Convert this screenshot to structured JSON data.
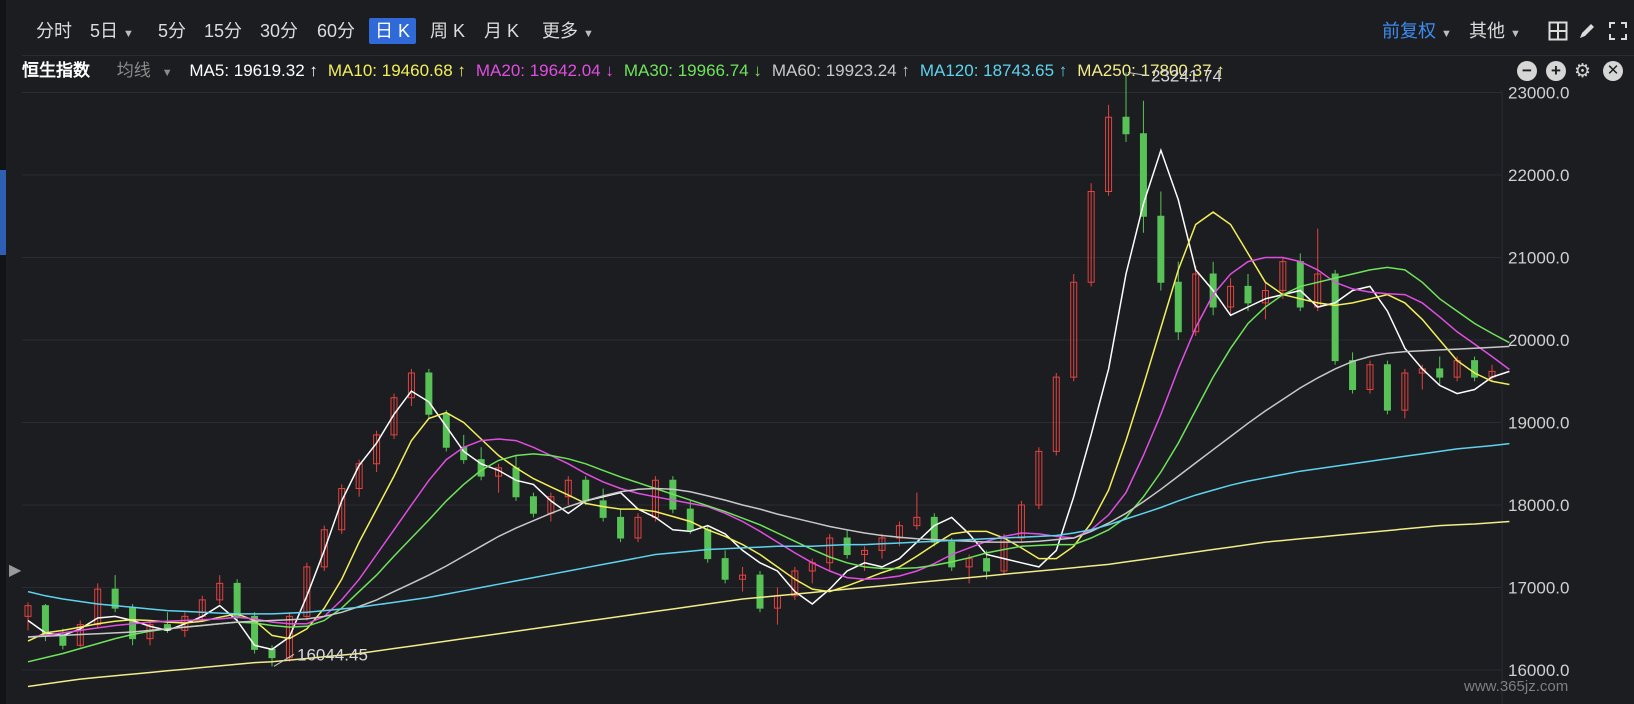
{
  "toolbar": {
    "timeframes": [
      {
        "label": "分时",
        "caret": false,
        "active": false
      },
      {
        "label": "5日",
        "caret": true,
        "active": false
      },
      {
        "label": "5分",
        "caret": false,
        "active": false
      },
      {
        "label": "15分",
        "caret": false,
        "active": false
      },
      {
        "label": "30分",
        "caret": false,
        "active": false
      },
      {
        "label": "60分",
        "caret": false,
        "active": false
      },
      {
        "label": "日 K",
        "caret": false,
        "active": true
      },
      {
        "label": "周 K",
        "caret": false,
        "active": false
      },
      {
        "label": "月 K",
        "caret": false,
        "active": false
      },
      {
        "label": "更多",
        "caret": true,
        "active": false
      }
    ],
    "adjust_label": "前复权",
    "other_label": "其他",
    "icons": [
      "layout-icon",
      "draw-tool-icon",
      "fullscreen-icon"
    ]
  },
  "ma_bar": {
    "index_name": "恒生指数",
    "avg_label": "均线",
    "items": [
      {
        "text": "MA5: 19619.32 ↑",
        "color": "#ffffff"
      },
      {
        "text": "MA10: 19460.68 ↑",
        "color": "#f3ef5a"
      },
      {
        "text": "MA20: 19642.04 ↓",
        "color": "#e04ee0"
      },
      {
        "text": "MA30: 19966.74 ↓",
        "color": "#6fe35a"
      },
      {
        "text": "MA60: 19923.24 ↑",
        "color": "#c8c8c8"
      },
      {
        "text": "MA120: 18743.65 ↑",
        "color": "#5fd3ee"
      },
      {
        "text": "MA250: 17800.37 ↑",
        "color": "#f2ec8a"
      }
    ],
    "controls": [
      "minus-icon",
      "plus-icon",
      "gear-icon",
      "close-icon"
    ]
  },
  "watermark": "www.365jz.com",
  "colors": {
    "up": "#e2433f",
    "down": "#58c257",
    "bg": "#1b1d21",
    "grid": "#2a2c31",
    "accent": "#2f6ad8"
  },
  "chart_data": {
    "type": "candlestick",
    "y_ticks": [
      "23000.0",
      "22000.0",
      "21000.0",
      "20000.0",
      "19000.0",
      "18000.0",
      "17000.0",
      "16000.0"
    ],
    "ylim": [
      15900,
      23450
    ],
    "annotations": [
      {
        "text": "23241.74",
        "value": 23241.74,
        "kind": "high"
      },
      {
        "text": "16044.45",
        "value": 16044.45,
        "kind": "low"
      }
    ],
    "series": [
      {
        "name": "MA5",
        "color": "#ffffff",
        "values": [
          16600,
          16450,
          16420,
          16500,
          16630,
          16650,
          16600,
          16530,
          16480,
          16560,
          16650,
          16780,
          16600,
          16300,
          16250,
          16400,
          16900,
          17450,
          18050,
          18480,
          18750,
          19100,
          19380,
          19250,
          18950,
          18650,
          18500,
          18420,
          18300,
          18250,
          18050,
          17900,
          18050,
          18100,
          18150,
          17950,
          17850,
          17700,
          17680,
          17750,
          17650,
          17450,
          17300,
          17200,
          16950,
          16800,
          16980,
          17200,
          17300,
          17250,
          17350,
          17550,
          17750,
          17850,
          17650,
          17400,
          17350,
          17300,
          17250,
          17450,
          18100,
          18850,
          19650,
          20800,
          21650,
          22300,
          21700,
          20850,
          20600,
          20300,
          20400,
          20500,
          20550,
          20600,
          20400,
          20450,
          20600,
          20650,
          20350,
          19900,
          19650,
          19450,
          19350,
          19400,
          19550,
          19619
        ]
      },
      {
        "name": "MA10",
        "color": "#f3ef5a",
        "values": [
          16350,
          16450,
          16480,
          16520,
          16560,
          16590,
          16610,
          16600,
          16580,
          16570,
          16590,
          16640,
          16680,
          16600,
          16420,
          16380,
          16500,
          16750,
          17100,
          17550,
          17950,
          18350,
          18780,
          19050,
          19120,
          19000,
          18800,
          18600,
          18450,
          18320,
          18220,
          18120,
          18020,
          17980,
          17950,
          17950,
          17920,
          17860,
          17800,
          17700,
          17620,
          17520,
          17400,
          17250,
          17100,
          16980,
          16950,
          17020,
          17100,
          17180,
          17250,
          17380,
          17520,
          17650,
          17680,
          17680,
          17600,
          17480,
          17350,
          17350,
          17500,
          17780,
          18180,
          18780,
          19450,
          20150,
          20850,
          21400,
          21550,
          21400,
          21050,
          20700,
          20550,
          20500,
          20450,
          20420,
          20450,
          20500,
          20550,
          20450,
          20250,
          20000,
          19750,
          19600,
          19500,
          19461
        ]
      },
      {
        "name": "MA20",
        "color": "#e04ee0",
        "values": [
          16400,
          16420,
          16450,
          16480,
          16510,
          16540,
          16560,
          16580,
          16590,
          16600,
          16610,
          16620,
          16640,
          16620,
          16580,
          16560,
          16560,
          16650,
          16850,
          17100,
          17400,
          17700,
          18000,
          18300,
          18550,
          18700,
          18780,
          18800,
          18780,
          18700,
          18600,
          18500,
          18380,
          18280,
          18200,
          18140,
          18100,
          18060,
          18020,
          17980,
          17900,
          17800,
          17680,
          17550,
          17420,
          17300,
          17200,
          17120,
          17100,
          17110,
          17140,
          17200,
          17290,
          17400,
          17480,
          17560,
          17620,
          17660,
          17650,
          17620,
          17600,
          17700,
          17880,
          18150,
          18600,
          19100,
          19650,
          20150,
          20550,
          20800,
          20950,
          21000,
          21000,
          20950,
          20850,
          20700,
          20620,
          20580,
          20560,
          20550,
          20450,
          20280,
          20100,
          19950,
          19800,
          19642
        ]
      },
      {
        "name": "MA30",
        "color": "#6fe35a",
        "values": [
          16100,
          16150,
          16200,
          16260,
          16320,
          16380,
          16430,
          16470,
          16500,
          16520,
          16540,
          16560,
          16580,
          16570,
          16540,
          16520,
          16530,
          16600,
          16750,
          16950,
          17150,
          17380,
          17600,
          17820,
          18050,
          18250,
          18420,
          18540,
          18600,
          18620,
          18600,
          18560,
          18500,
          18420,
          18340,
          18270,
          18200,
          18130,
          18060,
          17990,
          17920,
          17840,
          17760,
          17660,
          17560,
          17460,
          17370,
          17300,
          17250,
          17230,
          17230,
          17240,
          17270,
          17310,
          17360,
          17420,
          17460,
          17500,
          17510,
          17520,
          17520,
          17600,
          17700,
          17850,
          18100,
          18400,
          18750,
          19150,
          19550,
          19900,
          20200,
          20400,
          20550,
          20650,
          20700,
          20750,
          20800,
          20850,
          20880,
          20850,
          20700,
          20500,
          20350,
          20200,
          20080,
          19967
        ]
      },
      {
        "name": "MA60",
        "color": "#c8c8c8",
        "values": [
          16400,
          16410,
          16420,
          16430,
          16440,
          16450,
          16460,
          16480,
          16500,
          16520,
          16540,
          16560,
          16580,
          16590,
          16600,
          16610,
          16620,
          16650,
          16700,
          16770,
          16850,
          16950,
          17050,
          17150,
          17260,
          17380,
          17500,
          17620,
          17720,
          17810,
          17900,
          17980,
          18050,
          18110,
          18160,
          18190,
          18200,
          18190,
          18160,
          18110,
          18060,
          18000,
          17950,
          17890,
          17840,
          17790,
          17740,
          17700,
          17660,
          17630,
          17610,
          17590,
          17580,
          17570,
          17560,
          17550,
          17550,
          17550,
          17560,
          17580,
          17600,
          17680,
          17780,
          17900,
          18040,
          18190,
          18350,
          18510,
          18670,
          18830,
          18990,
          19140,
          19280,
          19420,
          19540,
          19650,
          19740,
          19800,
          19840,
          19860,
          19870,
          19880,
          19890,
          19900,
          19910,
          19923
        ]
      },
      {
        "name": "MA120",
        "color": "#5fd3ee",
        "values": [
          16950,
          16900,
          16860,
          16830,
          16800,
          16780,
          16760,
          16740,
          16720,
          16710,
          16700,
          16690,
          16680,
          16680,
          16680,
          16690,
          16700,
          16720,
          16740,
          16760,
          16790,
          16820,
          16850,
          16880,
          16920,
          16960,
          17000,
          17040,
          17080,
          17120,
          17160,
          17200,
          17240,
          17280,
          17320,
          17360,
          17400,
          17420,
          17440,
          17460,
          17470,
          17480,
          17490,
          17500,
          17500,
          17500,
          17510,
          17520,
          17520,
          17530,
          17540,
          17550,
          17560,
          17570,
          17580,
          17590,
          17600,
          17610,
          17620,
          17630,
          17660,
          17700,
          17760,
          17830,
          17900,
          17970,
          18050,
          18120,
          18180,
          18240,
          18290,
          18330,
          18370,
          18410,
          18440,
          18470,
          18500,
          18530,
          18560,
          18590,
          18620,
          18650,
          18680,
          18700,
          18720,
          18744
        ]
      },
      {
        "name": "MA250",
        "color": "#f2ec8a",
        "values": [
          15800,
          15830,
          15860,
          15890,
          15910,
          15930,
          15950,
          15970,
          15990,
          16010,
          16030,
          16050,
          16070,
          16090,
          16100,
          16120,
          16140,
          16160,
          16180,
          16200,
          16230,
          16260,
          16290,
          16320,
          16350,
          16380,
          16410,
          16440,
          16470,
          16500,
          16530,
          16560,
          16590,
          16620,
          16650,
          16680,
          16710,
          16740,
          16770,
          16800,
          16830,
          16860,
          16880,
          16900,
          16920,
          16940,
          16960,
          16980,
          17000,
          17020,
          17040,
          17060,
          17080,
          17100,
          17120,
          17140,
          17160,
          17180,
          17200,
          17220,
          17240,
          17260,
          17280,
          17310,
          17340,
          17370,
          17400,
          17430,
          17460,
          17490,
          17520,
          17550,
          17570,
          17590,
          17610,
          17630,
          17650,
          17670,
          17690,
          17710,
          17730,
          17750,
          17760,
          17770,
          17785,
          17800
        ]
      }
    ],
    "candles": [
      [
        16650,
        16820,
        16480,
        16780
      ],
      [
        16780,
        16800,
        16350,
        16420
      ],
      [
        16420,
        16500,
        16250,
        16300
      ],
      [
        16300,
        16600,
        16280,
        16550
      ],
      [
        16550,
        17050,
        16500,
        16980
      ],
      [
        16980,
        17150,
        16700,
        16750
      ],
      [
        16750,
        16800,
        16300,
        16380
      ],
      [
        16380,
        16600,
        16300,
        16550
      ],
      [
        16550,
        16700,
        16450,
        16480
      ],
      [
        16480,
        16700,
        16400,
        16650
      ],
      [
        16650,
        16900,
        16600,
        16850
      ],
      [
        16850,
        17150,
        16800,
        17050
      ],
      [
        17050,
        17100,
        16600,
        16650
      ],
      [
        16650,
        16700,
        16200,
        16250
      ],
      [
        16250,
        16300,
        16044,
        16150
      ],
      [
        16150,
        16700,
        16100,
        16650
      ],
      [
        16650,
        17300,
        16600,
        17250
      ],
      [
        17250,
        17750,
        17200,
        17700
      ],
      [
        17700,
        18250,
        17650,
        18200
      ],
      [
        18200,
        18550,
        18100,
        18500
      ],
      [
        18500,
        18900,
        18400,
        18850
      ],
      [
        18850,
        19350,
        18800,
        19300
      ],
      [
        19300,
        19650,
        19200,
        19600
      ],
      [
        19600,
        19650,
        19050,
        19100
      ],
      [
        19100,
        19150,
        18650,
        18700
      ],
      [
        18700,
        18850,
        18500,
        18550
      ],
      [
        18550,
        18700,
        18300,
        18350
      ],
      [
        18350,
        18500,
        18150,
        18450
      ],
      [
        18450,
        18600,
        18050,
        18100
      ],
      [
        18100,
        18150,
        17850,
        17900
      ],
      [
        17900,
        18150,
        17800,
        18100
      ],
      [
        18100,
        18350,
        18000,
        18300
      ],
      [
        18300,
        18350,
        18000,
        18050
      ],
      [
        18050,
        18200,
        17800,
        17850
      ],
      [
        17850,
        17950,
        17550,
        17600
      ],
      [
        17600,
        17900,
        17550,
        17850
      ],
      [
        17850,
        18350,
        17800,
        18300
      ],
      [
        18300,
        18350,
        17900,
        17950
      ],
      [
        17950,
        18050,
        17650,
        17700
      ],
      [
        17700,
        17750,
        17300,
        17350
      ],
      [
        17350,
        17450,
        17050,
        17100
      ],
      [
        17100,
        17250,
        16950,
        17150
      ],
      [
        17150,
        17200,
        16700,
        16750
      ],
      [
        16750,
        17000,
        16550,
        16900
      ],
      [
        16900,
        17250,
        16850,
        17200
      ],
      [
        17200,
        17350,
        17050,
        17300
      ],
      [
        17300,
        17650,
        17200,
        17600
      ],
      [
        17600,
        17700,
        17350,
        17400
      ],
      [
        17400,
        17500,
        17200,
        17450
      ],
      [
        17450,
        17650,
        17350,
        17600
      ],
      [
        17600,
        17800,
        17500,
        17750
      ],
      [
        17750,
        18150,
        17700,
        17850
      ],
      [
        17850,
        17900,
        17500,
        17550
      ],
      [
        17550,
        17600,
        17200,
        17250
      ],
      [
        17250,
        17400,
        17050,
        17350
      ],
      [
        17350,
        17450,
        17100,
        17200
      ],
      [
        17200,
        17650,
        17150,
        17600
      ],
      [
        17600,
        18050,
        17550,
        18000
      ],
      [
        18000,
        18700,
        17950,
        18650
      ],
      [
        18650,
        19600,
        18600,
        19550
      ],
      [
        19550,
        20800,
        19500,
        20700
      ],
      [
        20700,
        21900,
        20650,
        21800
      ],
      [
        21800,
        22850,
        21750,
        22700
      ],
      [
        22700,
        23242,
        22400,
        22500
      ],
      [
        22500,
        22900,
        21300,
        21500
      ],
      [
        21500,
        21800,
        20600,
        20700
      ],
      [
        20700,
        20950,
        20000,
        20100
      ],
      [
        20100,
        20900,
        20050,
        20800
      ],
      [
        20800,
        20950,
        20300,
        20400
      ],
      [
        20400,
        20750,
        20300,
        20650
      ],
      [
        20650,
        20800,
        20350,
        20450
      ],
      [
        20450,
        20700,
        20250,
        20600
      ],
      [
        20600,
        21000,
        20500,
        20950
      ],
      [
        20950,
        21050,
        20350,
        20400
      ],
      [
        20400,
        21350,
        20350,
        20800
      ],
      [
        20800,
        20850,
        19700,
        19750
      ],
      [
        19750,
        19850,
        19350,
        19400
      ],
      [
        19400,
        19750,
        19350,
        19700
      ],
      [
        19700,
        19750,
        19100,
        19150
      ],
      [
        19150,
        19650,
        19050,
        19600
      ],
      [
        19600,
        19700,
        19400,
        19650
      ],
      [
        19650,
        19800,
        19450,
        19550
      ],
      [
        19550,
        19800,
        19500,
        19750
      ],
      [
        19750,
        19800,
        19500,
        19550
      ],
      [
        19550,
        19700,
        19500,
        19620
      ]
    ]
  }
}
